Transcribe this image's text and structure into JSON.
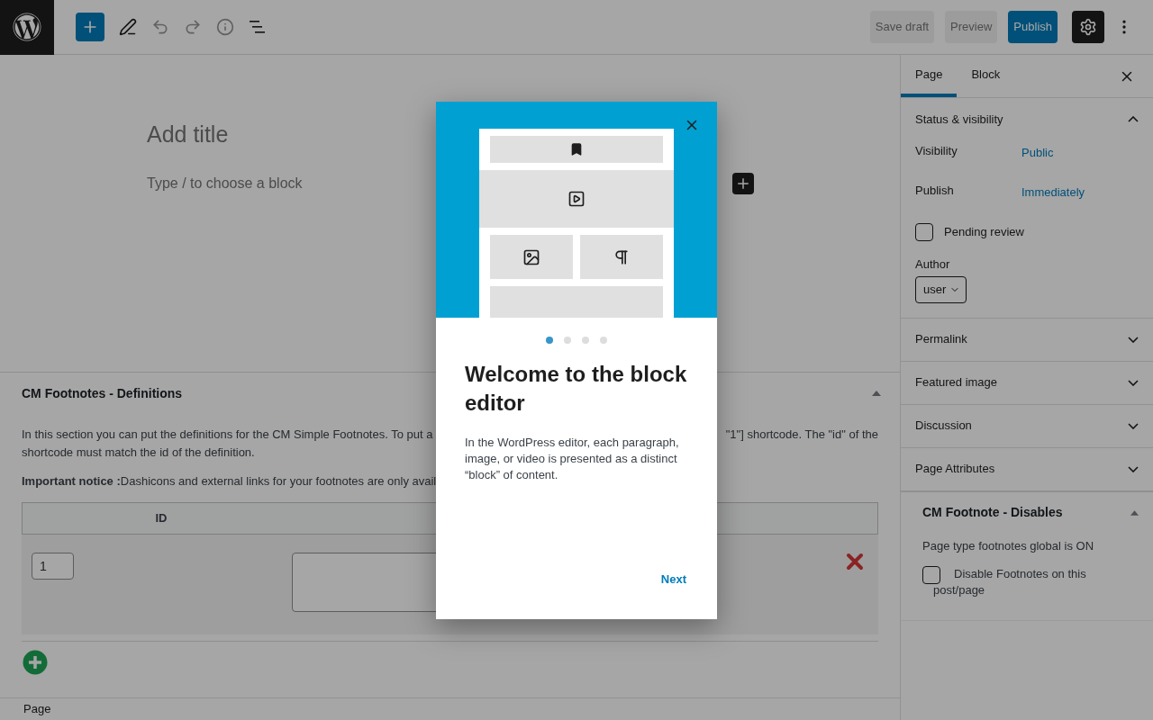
{
  "toolbar": {
    "settings_active": true,
    "actions": [
      {
        "label": "Save draft",
        "kind": "secondary"
      },
      {
        "label": "Preview",
        "kind": "secondary"
      },
      {
        "label": "Publish",
        "kind": "primary"
      }
    ]
  },
  "editor": {
    "title_placeholder": "Add title",
    "block_placeholder": "Type / to choose a block"
  },
  "metabox": {
    "title": "CM Footnotes - Definitions",
    "expanded": true,
    "intro_lines": [
      "In this section you can put the definitions for the CM Simple Footnotes. To put a",
      "shortcode must match the id of the definition."
    ],
    "intro_tail": "\"1\"] shortcode. The \"id\" of the",
    "notice": "**Important notice :**Dashicons and external links for your footnotes are only avail",
    "columns": [
      "ID"
    ],
    "rows": [
      {
        "id": "1"
      }
    ]
  },
  "status_bar": {
    "breadcrumb": "Page"
  },
  "sidebar": {
    "tabs": [
      {
        "label": "Page",
        "selected": true
      },
      {
        "label": "Block",
        "selected": false
      }
    ],
    "panels": [
      {
        "title": "Status & visibility",
        "expanded": true
      },
      {
        "title": "Permalink",
        "expanded": false
      },
      {
        "title": "Featured image",
        "expanded": false
      },
      {
        "title": "Discussion",
        "expanded": false
      },
      {
        "title": "Page Attributes",
        "expanded": false
      }
    ],
    "status": {
      "rows": [
        {
          "label": "Visibility",
          "value": "Public"
        },
        {
          "label": "Publish",
          "value": "Immediately"
        }
      ],
      "pending_review": {
        "label": "Pending review",
        "checked": false
      },
      "author": {
        "label": "Author",
        "value": "user"
      }
    },
    "footnote_panel": {
      "title": "CM Footnote - Disables",
      "expanded": true,
      "status_text": "Page type footnotes global is ON",
      "disable": {
        "label": "Disable Footnotes on this post/page",
        "checked": false
      }
    }
  },
  "modal": {
    "pages": [
      {
        "selected": true
      },
      {
        "selected": false
      },
      {
        "selected": false
      },
      {
        "selected": false
      }
    ],
    "title": "Welcome to the block editor",
    "body": "In the WordPress editor, each paragraph, image, or video is presented as a distinct “block” of content.",
    "next": "Next"
  }
}
